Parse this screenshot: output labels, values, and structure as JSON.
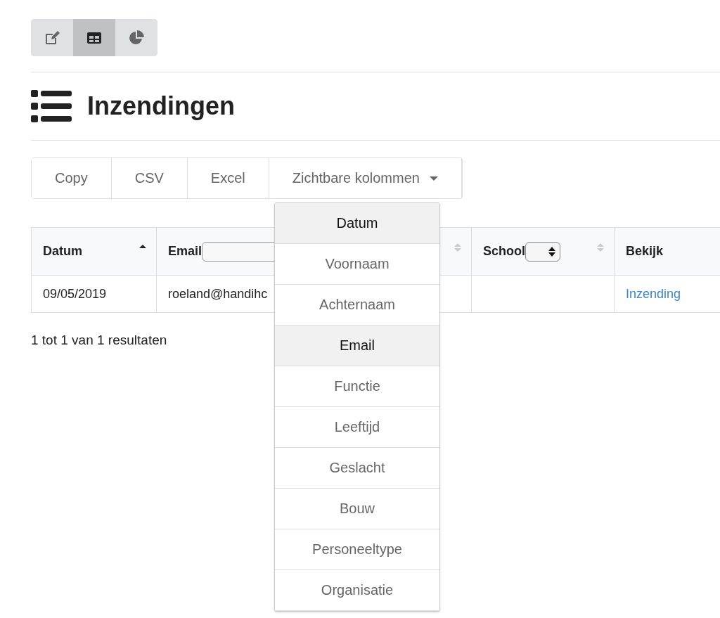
{
  "view_toggles": [
    {
      "kind": "edit",
      "selected": false
    },
    {
      "kind": "table",
      "selected": true
    },
    {
      "kind": "chart",
      "selected": false
    }
  ],
  "page_title": "Inzendingen",
  "export_buttons": [
    {
      "label": "Copy"
    },
    {
      "label": "CSV"
    },
    {
      "label": "Excel"
    }
  ],
  "column_menu": {
    "label": "Zichtbare kolommen",
    "expanded": true,
    "items": [
      {
        "label": "Datum",
        "selected": true
      },
      {
        "label": "Voornaam",
        "selected": false
      },
      {
        "label": "Achternaam",
        "selected": false
      },
      {
        "label": "Email",
        "selected": true
      },
      {
        "label": "Functie",
        "selected": false
      },
      {
        "label": "Leeftijd",
        "selected": false
      },
      {
        "label": "Geslacht",
        "selected": false
      },
      {
        "label": "Bouw",
        "selected": false
      },
      {
        "label": "Personeeltype",
        "selected": false
      },
      {
        "label": "Organisatie",
        "selected": false
      }
    ]
  },
  "table": {
    "columns": [
      {
        "label": "Datum",
        "kind": "plain",
        "sorted": true
      },
      {
        "label": "Email",
        "kind": "text-filter",
        "sorted": false
      },
      {
        "label": "School",
        "kind": "select-filter",
        "sorted": false
      },
      {
        "label": "Bekijk",
        "kind": "plain"
      }
    ],
    "rows": [
      [
        {
          "text": "09/05/2019",
          "kind": "text"
        },
        {
          "text": "roeland@handihc",
          "kind": "text"
        },
        {
          "kind": "empty"
        },
        {
          "text": "Inzending",
          "kind": "link"
        }
      ]
    ]
  },
  "result_info": "1 tot 1 van 1 resultaten"
}
